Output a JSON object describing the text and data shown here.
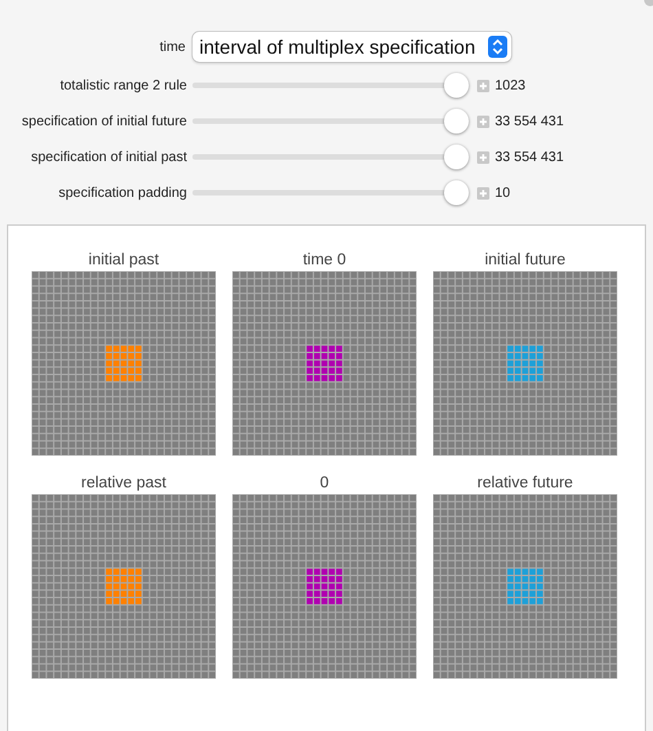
{
  "controls": {
    "popup": {
      "label": "time",
      "value": "interval of multiplex specification"
    },
    "sliders": [
      {
        "label": "totalistic range 2 rule",
        "level": 0.97,
        "reading": "1023"
      },
      {
        "label": "specification of initial future",
        "level": 0.97,
        "reading": "33 554 431"
      },
      {
        "label": "specification of initial past",
        "level": 0.97,
        "reading": "33 554 431"
      },
      {
        "label": "specification padding",
        "level": 0.97,
        "reading": "10"
      }
    ]
  },
  "panels": [
    {
      "title": "initial past",
      "color": "#ff8000"
    },
    {
      "title": "time 0",
      "color": "#b000b0"
    },
    {
      "title": "initial future",
      "color": "#1ea0d8"
    },
    {
      "title": "relative past",
      "color": "#ff8000"
    },
    {
      "title": "0",
      "color": "#b000b0"
    },
    {
      "title": "relative future",
      "color": "#1ea0d8"
    }
  ]
}
